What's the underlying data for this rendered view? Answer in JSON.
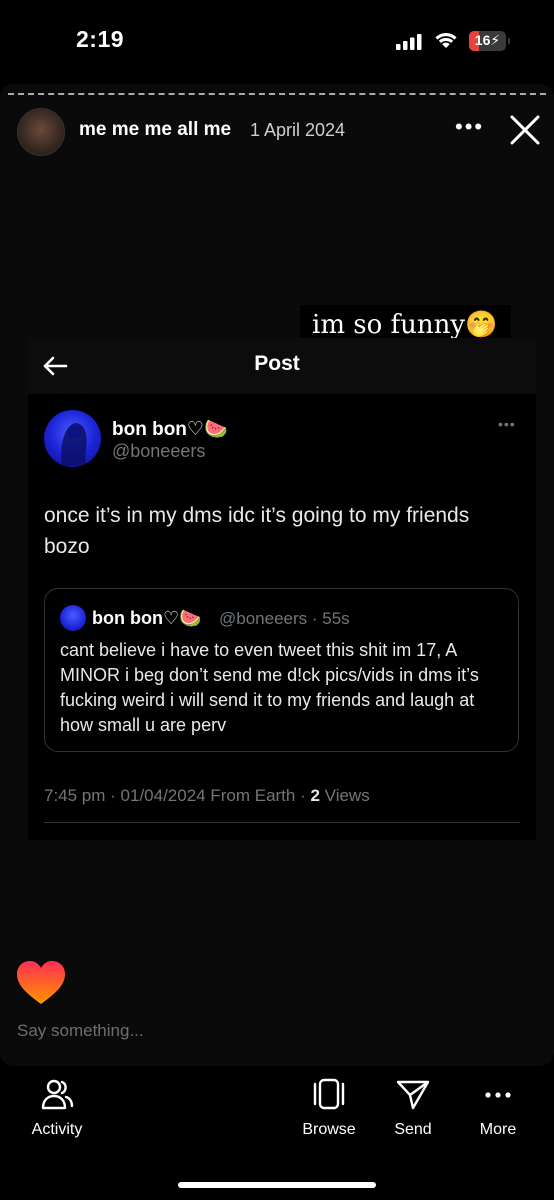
{
  "status_bar": {
    "time": "2:19",
    "battery": "16",
    "battery_level": 0.16
  },
  "story": {
    "username": "me me me all me",
    "date": "1 April 2024",
    "caption": "im so funny",
    "caption_emoji": "🤭"
  },
  "post": {
    "header_title": "Post",
    "author_name": "bon bon♡",
    "author_emoji": "🍉",
    "author_handle": "@boneeers",
    "text": "once it’s in my dms idc it’s going to my friends bozo",
    "quote": {
      "author_name": "bon bon♡",
      "author_emoji": "🍉",
      "handle_time": "@boneeers · 55s",
      "text": "cant believe i have to even tweet this shit im 17, A MINOR i beg don’t send me d!ck pics/vids in dms it’s fucking weird i will send it to my friends and laugh at how small u are perv"
    },
    "meta_prefix": "7:45 pm · 01/04/2024 From Earth · ",
    "views_count": "2",
    "views_label": " Views"
  },
  "reply": {
    "placeholder": "Say something..."
  },
  "nav": {
    "activity": "Activity",
    "browse": "Browse",
    "send": "Send",
    "more": "More"
  },
  "colors": {
    "battery_red": "#e5443c",
    "muted": "#71767b",
    "heart_top": "#ff2d55",
    "heart_bottom": "#ff9500"
  }
}
